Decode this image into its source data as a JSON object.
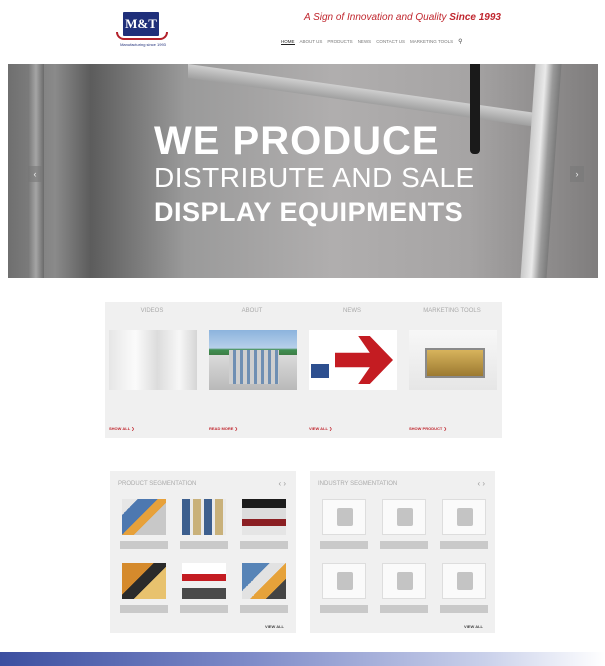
{
  "header": {
    "logo_text": "M&T",
    "logo_subtext": "Manufacturing since 1993",
    "tagline_prefix": "A Sign of Innovation and Quality",
    "tagline_highlight": "Since 1993"
  },
  "nav": {
    "items": [
      {
        "label": "HOME",
        "active": true
      },
      {
        "label": "ABOUT US"
      },
      {
        "label": "PRODUCTS"
      },
      {
        "label": "NEWS"
      },
      {
        "label": "CONTACT US"
      },
      {
        "label": "MARKETING TOOLS"
      }
    ],
    "search_icon": "search-icon",
    "search_glyph": "⚲"
  },
  "hero": {
    "title": "WE PRODUCE",
    "subtitle1": "DISTRIBUTE AND SALE",
    "subtitle2": "DISPLAY EQUIPMENTS",
    "prev_glyph": "‹",
    "next_glyph": "›"
  },
  "features": [
    {
      "title": "VIDEOS",
      "desc": "",
      "link": "SHOW ALL ❯"
    },
    {
      "title": "ABOUT",
      "desc": "",
      "link": "READ MORE ❯"
    },
    {
      "title": "NEWS",
      "desc": "",
      "link": "VIEW ALL ❯"
    },
    {
      "title": "MARKETING TOOLS",
      "desc": "",
      "link": "SHOW PRODUCT ❯"
    }
  ],
  "panels": {
    "product": {
      "title": "PRODUCT SEGMENTATION",
      "nav_glyphs": "‹ ›",
      "view_all": "VIEW ALL"
    },
    "industry": {
      "title": "INDUSTRY SEGMENTATION",
      "nav_glyphs": "‹ ›",
      "view_all": "VIEW ALL"
    }
  },
  "colors": {
    "brand_blue": "#1f2f7a",
    "accent_red": "#c0262e",
    "panel_bg": "#f0f0f0"
  }
}
